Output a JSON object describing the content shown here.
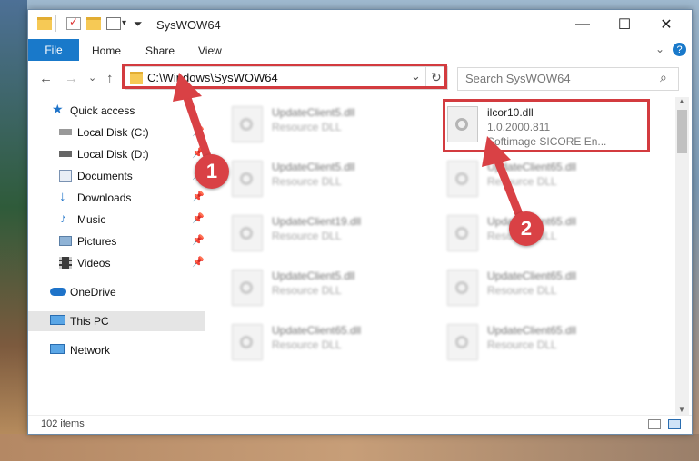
{
  "window": {
    "title": "SysWOW64",
    "controls": {
      "minimize": "—",
      "maximize": "☐",
      "close": "✕"
    }
  },
  "ribbon": {
    "tabs": [
      "File",
      "Home",
      "Share",
      "View"
    ],
    "expand_icon": "chevron-down-icon",
    "help_icon": "?"
  },
  "address_bar": {
    "path": "C:\\Windows\\SysWOW64",
    "dropdown_icon": "⌄",
    "refresh_icon": "↻"
  },
  "search": {
    "placeholder": "Search SysWOW64",
    "icon": "⌕"
  },
  "nav_buttons": {
    "back": "←",
    "forward": "→",
    "recent": "⌄",
    "up": "↑"
  },
  "sidebar": {
    "items": [
      {
        "label": "Quick access",
        "icon": "star-icon",
        "pinned": false
      },
      {
        "label": "Local Disk (C:)",
        "icon": "drive-icon",
        "pinned": true
      },
      {
        "label": "Local Disk (D:)",
        "icon": "drive-icon",
        "pinned": true
      },
      {
        "label": "Documents",
        "icon": "documents-icon",
        "pinned": true
      },
      {
        "label": "Downloads",
        "icon": "download-icon",
        "pinned": true
      },
      {
        "label": "Music",
        "icon": "music-icon",
        "pinned": true
      },
      {
        "label": "Pictures",
        "icon": "pictures-icon",
        "pinned": true
      },
      {
        "label": "Videos",
        "icon": "videos-icon",
        "pinned": true
      },
      {
        "label": "OneDrive",
        "icon": "cloud-icon",
        "pinned": false
      },
      {
        "label": "This PC",
        "icon": "computer-icon",
        "pinned": false,
        "selected": true
      },
      {
        "label": "Network",
        "icon": "network-icon",
        "pinned": false
      }
    ]
  },
  "files": [
    {
      "name": "UpdateClient5.dll",
      "desc": "Resource DLL"
    },
    {
      "name": "ilcor10.dll",
      "version": "1.0.2000.811",
      "desc": "Softimage SICORE En...",
      "highlighted": true
    },
    {
      "name": "UpdateClient5.dll",
      "desc": "Resource DLL"
    },
    {
      "name": "UpdateClient65.dll",
      "desc": "Resource DLL"
    },
    {
      "name": "UpdateClient19.dll",
      "desc": "Resource DLL"
    },
    {
      "name": "UpdateClient65.dll",
      "desc": "Resource DLL"
    },
    {
      "name": "UpdateClient5.dll",
      "desc": "Resource DLL"
    },
    {
      "name": "UpdateClient65.dll",
      "desc": "Resource DLL"
    },
    {
      "name": "UpdateClient65.dll",
      "desc": "Resource DLL"
    },
    {
      "name": "UpdateClient65.dll",
      "desc": "Resource DLL"
    }
  ],
  "status_bar": {
    "item_count": "102 items"
  },
  "annotations": {
    "badge1": "1",
    "badge2": "2"
  },
  "colors": {
    "accent": "#1979ca",
    "highlight": "#d33b3f"
  }
}
